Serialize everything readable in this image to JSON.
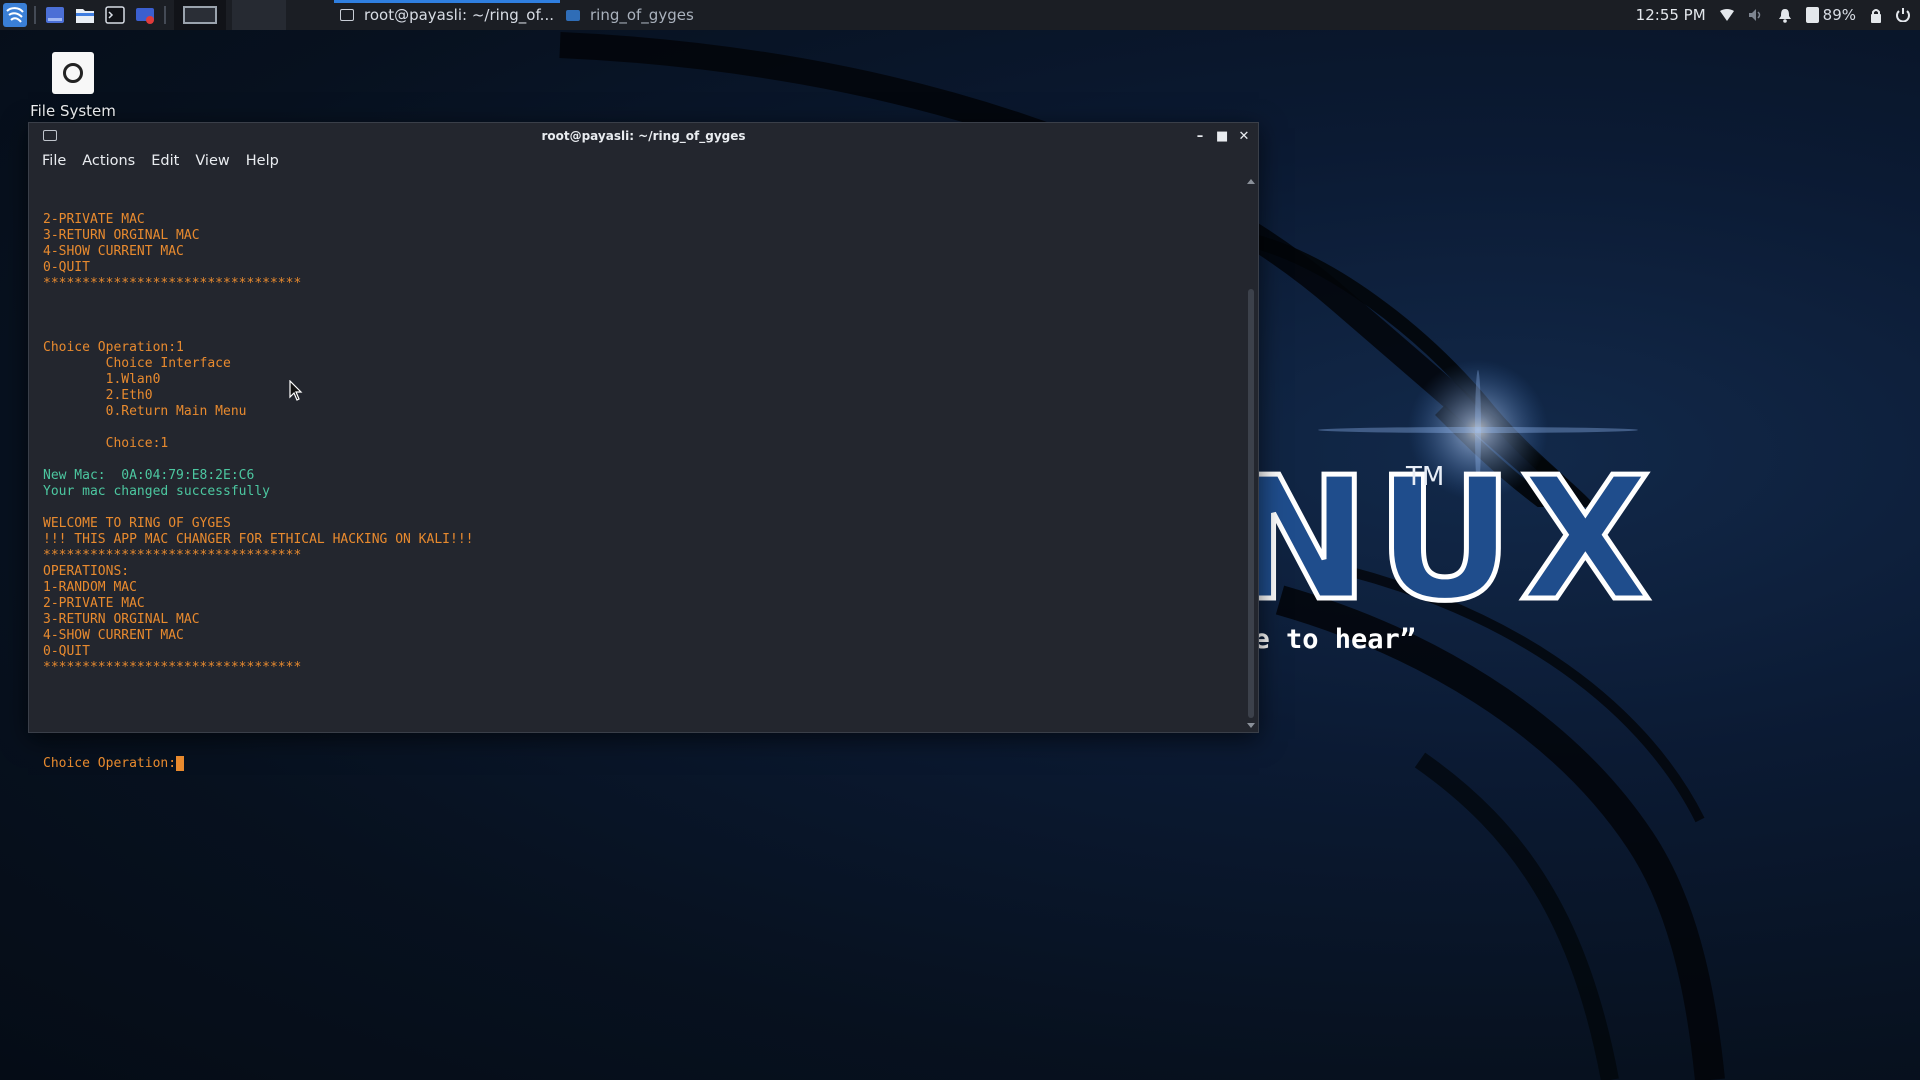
{
  "panel": {
    "tasks": [
      {
        "label": "root@payasli: ~/ring_of...",
        "icon": "terminal-icon",
        "active": true
      },
      {
        "label": "ring_of_gyges",
        "icon": "folder-icon",
        "active": false
      }
    ],
    "clock": "12:55 PM",
    "battery": "89%"
  },
  "desktop": {
    "icon_label": "File System"
  },
  "wallpaper": {
    "logo": "KALI LINUX",
    "tm": "TM",
    "slogan": "“the quieter you become, the more you are able to hear”"
  },
  "window": {
    "title": "root@payasli: ~/ring_of_gyges",
    "menu": [
      "File",
      "Actions",
      "Edit",
      "View",
      "Help"
    ]
  },
  "terminal": {
    "lines": [
      {
        "text": "2-PRIVATE MAC",
        "style": "orange"
      },
      {
        "text": "3-RETURN ORGINAL MAC",
        "style": "orange"
      },
      {
        "text": "4-SHOW CURRENT MAC",
        "style": "orange"
      },
      {
        "text": "0-QUIT",
        "style": "orange"
      },
      {
        "text": "*********************************",
        "style": "orange"
      },
      {
        "text": "",
        "style": "orange"
      },
      {
        "text": "",
        "style": "orange"
      },
      {
        "text": "",
        "style": "orange"
      },
      {
        "text": "Choice Operation:1",
        "style": "orange"
      },
      {
        "text": "        Choice Interface",
        "style": "orange"
      },
      {
        "text": "        1.Wlan0",
        "style": "orange"
      },
      {
        "text": "        2.Eth0",
        "style": "orange"
      },
      {
        "text": "        0.Return Main Menu",
        "style": "orange"
      },
      {
        "text": "",
        "style": "orange"
      },
      {
        "text": "        Choice:1",
        "style": "orange"
      },
      {
        "text": "",
        "style": "orange"
      },
      {
        "text": "New Mac:  0A:04:79:E8:2E:C6",
        "style": "green"
      },
      {
        "text": "Your mac changed successfully",
        "style": "green"
      },
      {
        "text": "",
        "style": "orange"
      },
      {
        "text": "WELCOME TO RING OF GYGES",
        "style": "orange"
      },
      {
        "text": "!!! THIS APP MAC CHANGER FOR ETHICAL HACKING ON KALI!!!",
        "style": "orange"
      },
      {
        "text": "*********************************",
        "style": "orange"
      },
      {
        "text": "OPERATIONS:",
        "style": "orange"
      },
      {
        "text": "1-RANDOM MAC",
        "style": "orange"
      },
      {
        "text": "2-PRIVATE MAC",
        "style": "orange"
      },
      {
        "text": "3-RETURN ORGINAL MAC",
        "style": "orange"
      },
      {
        "text": "4-SHOW CURRENT MAC",
        "style": "orange"
      },
      {
        "text": "0-QUIT",
        "style": "orange"
      },
      {
        "text": "*********************************",
        "style": "orange"
      },
      {
        "text": "",
        "style": "orange"
      },
      {
        "text": "",
        "style": "orange"
      },
      {
        "text": "",
        "style": "orange"
      }
    ],
    "prompt": "Choice Operation:",
    "colors": {
      "orange": "#e88a2e",
      "green": "#4cc7a0",
      "background": "#23262e"
    }
  }
}
